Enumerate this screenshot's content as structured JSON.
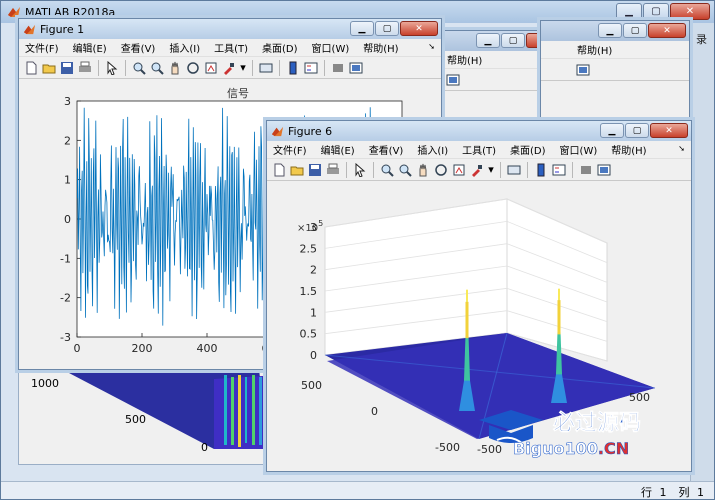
{
  "app": {
    "title": "MATLAB R2018a",
    "side_labels": [
      "录"
    ],
    "status": {
      "row_label": "行",
      "row_value": "1",
      "col_label": "列",
      "col_value": "1"
    }
  },
  "figure_menu": [
    "文件(F)",
    "编辑(E)",
    "查看(V)",
    "插入(I)",
    "工具(T)",
    "桌面(D)",
    "窗口(W)",
    "帮助(H)"
  ],
  "background_figures": [
    {
      "menu_tail": "帮助(H)"
    },
    {
      "menu_tail": "帮助(H)"
    }
  ],
  "figure1": {
    "title": "Figure 1",
    "chart_data": {
      "type": "line",
      "title": "信号",
      "xlim": [
        0,
        1000
      ],
      "ylim": [
        -3,
        3
      ],
      "x_ticks": [
        "0",
        "200",
        "400",
        "600"
      ],
      "y_ticks": [
        "3",
        "2",
        "1",
        "0",
        "-1",
        "-2",
        "-3"
      ],
      "series": [
        {
          "color": "#0072bd",
          "samples": 1000
        }
      ]
    }
  },
  "behind_surface": {
    "y_ticks": [
      "1000",
      "500",
      "0"
    ],
    "x_ticks": [
      "0",
      "2"
    ]
  },
  "figure6": {
    "title": "Figure 6",
    "chart_data": {
      "type": "surface",
      "exponent_label": "×10",
      "exponent_power": "5",
      "z_ticks": [
        "3",
        "2.5",
        "2",
        "1.5",
        "1",
        "0.5",
        "0"
      ],
      "y_ticks": [
        "500",
        "0",
        "-500"
      ],
      "x_ticks": [
        "-500",
        "500"
      ],
      "zlim": [
        0,
        300000
      ],
      "peaks": [
        {
          "x": -200,
          "y": 120,
          "z": 260000
        },
        {
          "x": 220,
          "y": 80,
          "z": 245000
        }
      ],
      "colormap": "parula"
    }
  },
  "watermark": {
    "text_cn": "必过源码",
    "text_en": "Biguo100",
    "text_en_tail": ".CN",
    "brand_color": "#1a56c8"
  }
}
